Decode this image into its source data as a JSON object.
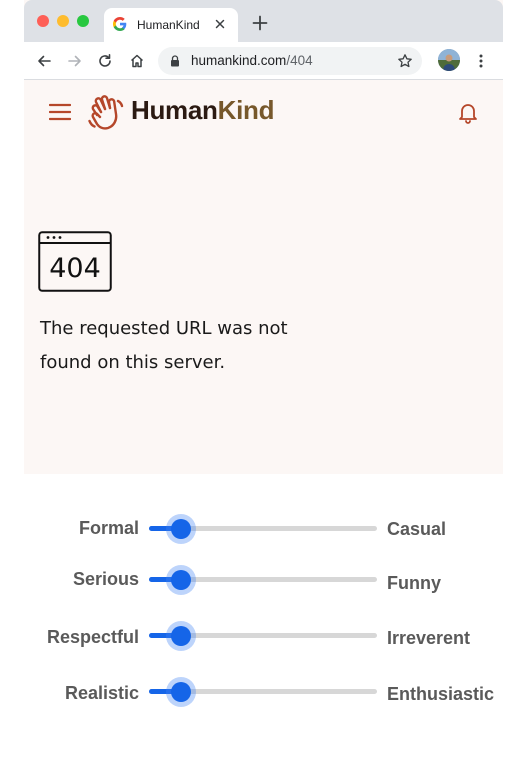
{
  "browser": {
    "tab_title": "HumanKind",
    "url_domain": "humankind.com",
    "url_path": "/404"
  },
  "site": {
    "brand_part1": "Human",
    "brand_part2": "Kind",
    "error_code": "404",
    "error_message": "The requested URL was not found on this server."
  },
  "sliders": [
    {
      "left": "Formal",
      "right": "Casual",
      "value": 0.14
    },
    {
      "left": "Serious",
      "right": "Funny",
      "value": 0.14
    },
    {
      "left": "Respectful",
      "right": "Irreverent",
      "value": 0.14
    },
    {
      "left": "Realistic",
      "right": "Enthusiastic",
      "value": 0.14
    }
  ],
  "colors": {
    "accent": "#1565e8",
    "brand_dark": "#2b1a12",
    "brand_gold": "#77582b",
    "icon_rust": "#b5472a",
    "page_bg": "#fcf7f5"
  }
}
